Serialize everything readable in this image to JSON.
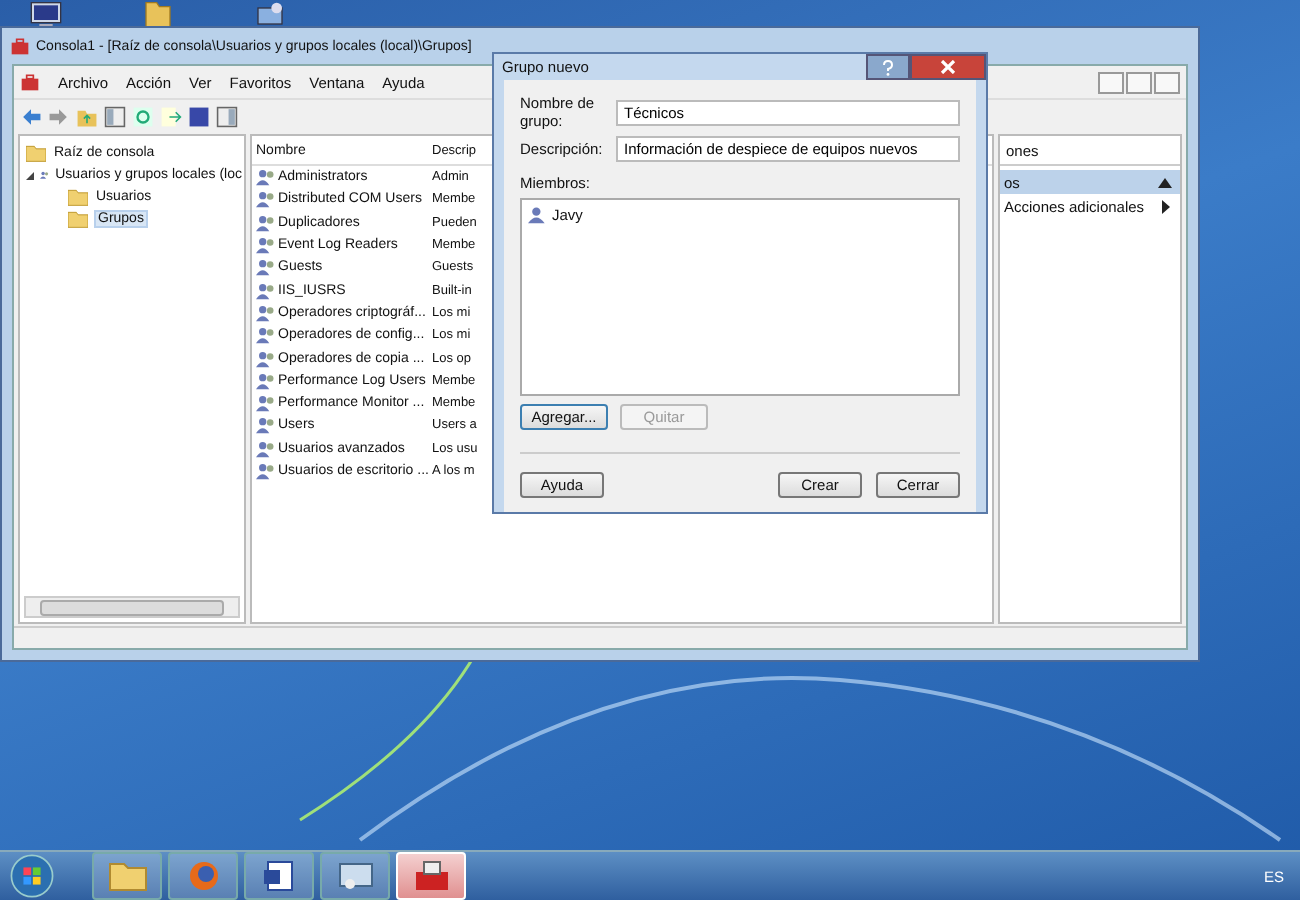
{
  "desktop_icons": [
    {
      "kind": "computer"
    },
    {
      "kind": "folder"
    },
    {
      "kind": "network"
    }
  ],
  "mmc_window": {
    "title": "Consola1 - [Raíz de consola\\Usuarios y grupos locales (local)\\Grupos]",
    "menu": [
      "Archivo",
      "Acción",
      "Ver",
      "Favoritos",
      "Ventana",
      "Ayuda"
    ],
    "tree": [
      {
        "label": "Raíz de consola",
        "kind": "folder",
        "selected": false,
        "children": [
          {
            "label": "Usuarios y grupos locales (loc",
            "kind": "users",
            "selected": false,
            "expanded": true,
            "children": [
              {
                "label": "Usuarios",
                "kind": "folder",
                "selected": false
              },
              {
                "label": "Grupos",
                "kind": "folder",
                "selected": true
              }
            ]
          }
        ]
      }
    ],
    "list": {
      "columns": [
        "Nombre",
        "Descrip"
      ],
      "rows": [
        {
          "name": "Administrators",
          "description": "Admin"
        },
        {
          "name": "Distributed COM Users",
          "description": "Membe"
        },
        {
          "name": "Duplicadores",
          "description": "Pueden"
        },
        {
          "name": "Event Log Readers",
          "description": "Membe"
        },
        {
          "name": "Guests",
          "description": "Guests"
        },
        {
          "name": "IIS_IUSRS",
          "description": "Built-in"
        },
        {
          "name": "Operadores criptográf...",
          "description": "Los mi"
        },
        {
          "name": "Operadores de config...",
          "description": "Los mi"
        },
        {
          "name": "Operadores de copia ...",
          "description": "Los op"
        },
        {
          "name": "Performance Log Users",
          "description": "Membe"
        },
        {
          "name": "Performance Monitor ...",
          "description": "Membe"
        },
        {
          "name": "Users",
          "description": "Users a"
        },
        {
          "name": "Usuarios avanzados",
          "description": "Los usu"
        },
        {
          "name": "Usuarios de escritorio ...",
          "description": "A los m"
        }
      ]
    },
    "actions": {
      "header": "ones",
      "section": "os",
      "items": [
        "Acciones adicionales"
      ]
    }
  },
  "dialog": {
    "title": "Grupo nuevo",
    "fields": [
      {
        "label": "Nombre de grupo:",
        "value": "Técnicos"
      },
      {
        "label": "Descripción:",
        "value": "Información de despiece de equipos nuevos"
      }
    ],
    "members_label": "Miembros:",
    "members": [
      "Javy"
    ],
    "member_buttons": [
      {
        "label": "Agregar...",
        "disabled": false
      },
      {
        "label": "Quitar",
        "disabled": true
      }
    ],
    "footer_left": [
      {
        "label": "Ayuda",
        "disabled": false
      }
    ],
    "footer_right": [
      {
        "label": "Crear",
        "disabled": false
      },
      {
        "label": "Cerrar",
        "disabled": false
      }
    ]
  },
  "taskbar": {
    "apps": [
      {
        "kind": "folder",
        "active": false
      },
      {
        "kind": "browser",
        "active": false
      },
      {
        "kind": "document",
        "active": false
      },
      {
        "kind": "panel",
        "active": false
      },
      {
        "kind": "toolbox",
        "active": true
      }
    ],
    "language": "ES"
  }
}
